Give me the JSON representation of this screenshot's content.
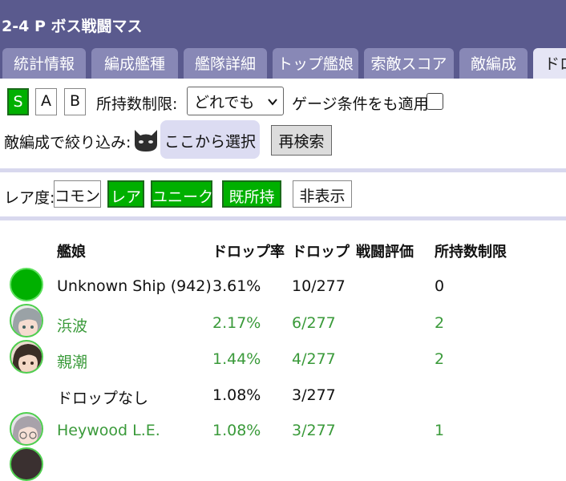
{
  "title": "2-4 P ボス戦闘マス",
  "tabs": [
    "統計情報",
    "編成艦種",
    "艦隊詳細",
    "トップ艦娘",
    "索敵スコア",
    "敵編成",
    "ドロ"
  ],
  "filters": {
    "rank_buttons": [
      {
        "label": "S",
        "on": true
      },
      {
        "label": "A",
        "on": false
      },
      {
        "label": "B",
        "on": false
      }
    ],
    "ownership_limit_label": "所持数制限:",
    "ownership_limit_value": "どれでも",
    "gauge_label": "ゲージ条件をも適用:",
    "enemy_filter_label": "敵編成で絞り込み:",
    "choose_label": "ここから選択",
    "research_label": "再検索"
  },
  "rarity": {
    "label": "レア度:",
    "buttons": [
      {
        "label": "コモン",
        "on": false
      },
      {
        "label": "レア",
        "on": true
      },
      {
        "label": "ユニーク",
        "on": true
      },
      {
        "label": "既所持",
        "on": true
      },
      {
        "label": "非表示",
        "on": false
      }
    ]
  },
  "table": {
    "headers": [
      "艦娘",
      "ドロップ率",
      "ドロップ",
      "戦闘評価",
      "所持数制限"
    ],
    "rows": [
      {
        "name": "Unknown Ship (942)",
        "rate": "3.61%",
        "drop": "10/277",
        "eval": "",
        "limit": "0",
        "avatar": "green-dot",
        "color": "#111111"
      },
      {
        "name": "浜波",
        "rate": "2.17%",
        "drop": "6/277",
        "eval": "",
        "limit": "2",
        "avatar": "hamanami",
        "color": "#3a9a3a"
      },
      {
        "name": "親潮",
        "rate": "1.44%",
        "drop": "4/277",
        "eval": "",
        "limit": "2",
        "avatar": "oyashio",
        "color": "#3a9a3a"
      },
      {
        "name": "ドロップなし",
        "rate": "1.08%",
        "drop": "3/277",
        "eval": "",
        "limit": "",
        "avatar": "",
        "color": "#111111"
      },
      {
        "name": "Heywood L.E.",
        "rate": "1.08%",
        "drop": "3/277",
        "eval": "",
        "limit": "1",
        "avatar": "heywood",
        "color": "#3a9a3a"
      }
    ]
  },
  "colors": {
    "header_bg": "#5a5a8e",
    "tab_bg": "#8888b6",
    "toggle_on": "#00b000",
    "owned_text": "#3a9a3a"
  }
}
